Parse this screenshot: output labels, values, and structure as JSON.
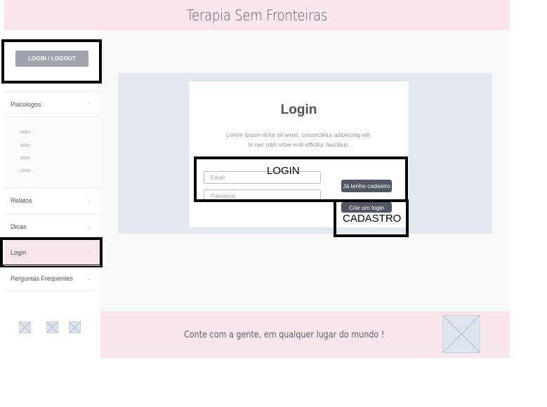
{
  "header": {
    "title": "Terapia Sem Fronteiras"
  },
  "sidebar": {
    "login_logout_label": "LOGIN / LOGOUT",
    "items": [
      {
        "label": "Psicologos",
        "expanded": true,
        "sub_items": [
          "xxxx",
          "xxxx",
          "xxxx",
          "xxxx"
        ]
      },
      {
        "label": "Relatos"
      },
      {
        "label": "Dicas"
      },
      {
        "label": "Login",
        "active": true
      },
      {
        "label": "Perguntas Frequentes"
      }
    ],
    "social_icons": [
      "image-placeholder-icon",
      "image-placeholder-icon",
      "image-placeholder-icon"
    ]
  },
  "login": {
    "title": "Login",
    "description_line1": "Lorem ipsum dolor sit amet, consectetur adipiscing elit.",
    "description_line2": "In nec nibh vitae erat efficitur faucibus.",
    "email_placeholder": "Email",
    "password_placeholder": "Password",
    "existing_account_button": "Já tenho cadastro",
    "create_login_button": "Crie um login"
  },
  "annotations": {
    "login_label": "LOGIN",
    "cadastro_label": "CADASTRO"
  },
  "footer": {
    "tagline": "Conte com a gente, em qualquer lugar do mundo !"
  },
  "colors": {
    "header_bg": "#f9e6ec",
    "content_panel_bg": "#e3e7ef",
    "dark_button": "#505764",
    "light_button": "#9ea4ae",
    "annotation_border": "#000000"
  }
}
